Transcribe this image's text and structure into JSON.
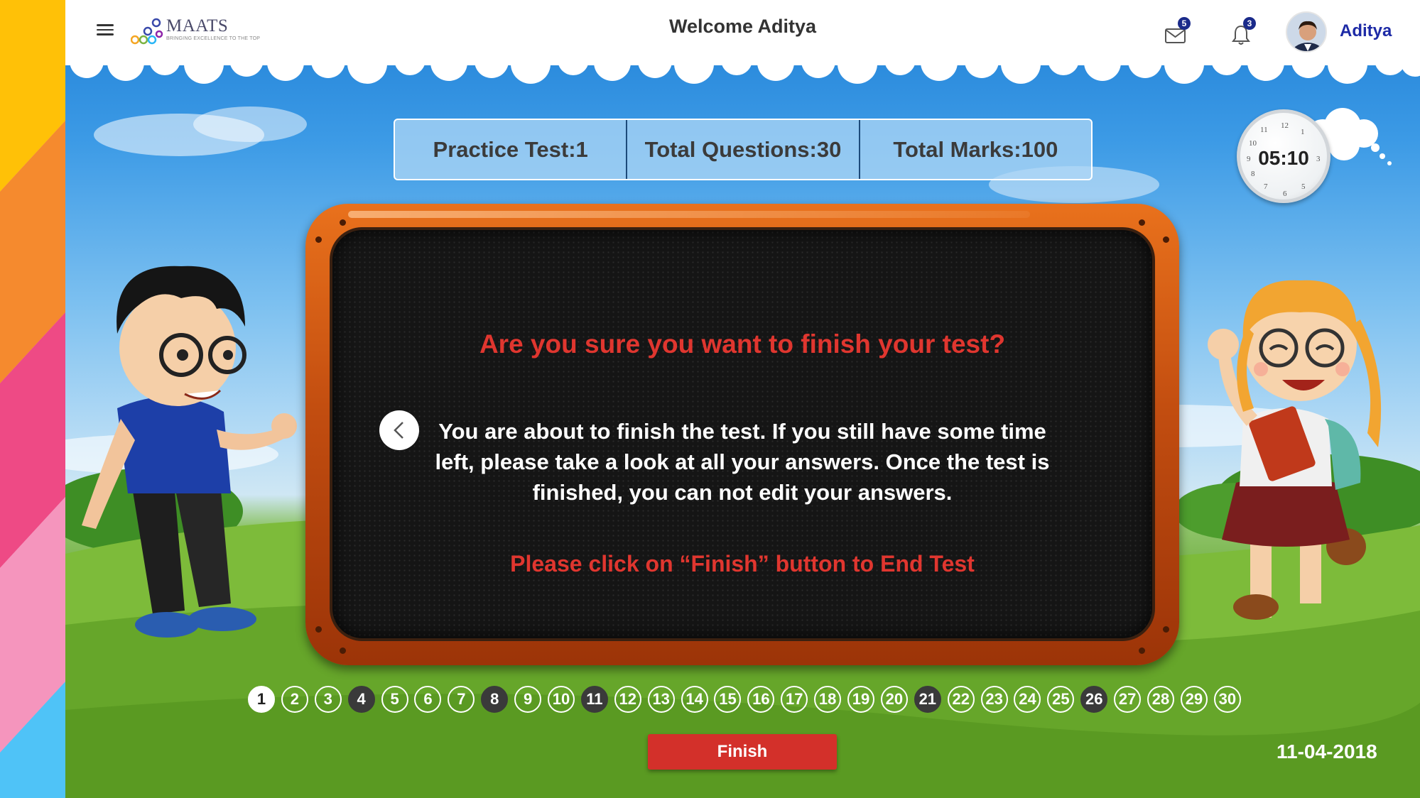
{
  "header": {
    "logo_text": "MAATS",
    "logo_tagline": "BRINGING EXCELLENCE TO THE TOP",
    "welcome": "Welcome Aditya",
    "messages_count": "5",
    "notifications_count": "3",
    "user_name": "Aditya"
  },
  "info": {
    "practice_test": "Practice Test:1",
    "total_questions": "Total Questions:30",
    "total_marks": "Total Marks:100"
  },
  "timer": {
    "time": "05:10",
    "clock_numbers": [
      "12",
      "1",
      "3",
      "5",
      "6",
      "7",
      "8",
      "9",
      "10",
      "11"
    ]
  },
  "dialog": {
    "title": "Are you sure you want to finish your test?",
    "body": "You are about to finish the test. If you still have some time left, please take a look at all your answers. Once the test is finished, you can not edit your answers.",
    "note": "Please click on “Finish” button to End Test"
  },
  "questions": {
    "numbers": [
      "1",
      "2",
      "3",
      "4",
      "5",
      "6",
      "7",
      "8",
      "9",
      "10",
      "11",
      "12",
      "13",
      "14",
      "15",
      "16",
      "17",
      "18",
      "19",
      "20",
      "21",
      "22",
      "23",
      "24",
      "25",
      "26",
      "27",
      "28",
      "29",
      "30"
    ],
    "current": "1",
    "visited": [
      "4",
      "8",
      "11",
      "21",
      "26"
    ]
  },
  "footer": {
    "finish_label": "Finish",
    "date": "11-04-2018"
  },
  "colors": {
    "accent_red": "#d3302a",
    "title_red": "#e0362f",
    "user_blue": "#1d2aa6",
    "badge_navy": "#1a2a8a"
  }
}
